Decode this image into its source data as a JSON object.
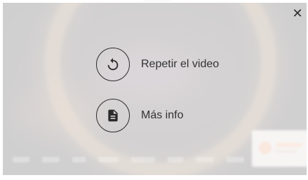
{
  "overlay": {
    "close_icon": "close-icon",
    "actions": [
      {
        "label": "Repetir el video",
        "icon": "replay-icon"
      },
      {
        "label": "Más info",
        "icon": "document-icon"
      }
    ]
  }
}
